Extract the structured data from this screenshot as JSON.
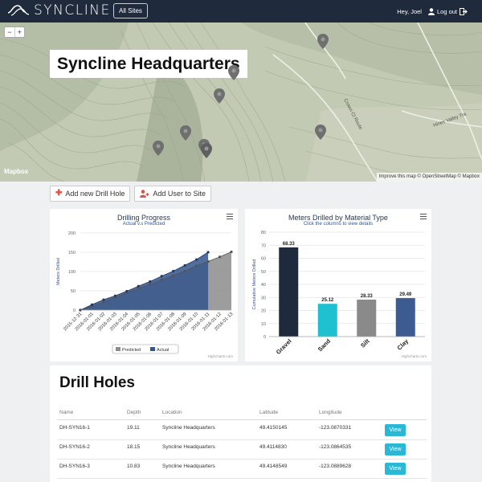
{
  "navbar": {
    "brand": "SYNCLINE",
    "all_sites_label": "All Sites",
    "greeting": "Hey, Joel",
    "logout_label": "Log out"
  },
  "map": {
    "title": "Syncline Headquarters",
    "zoom_in": "+",
    "zoom_out": "−",
    "logo": "Mapbox",
    "attribution": "Improve this map © OpenStreetMap © Mapbox",
    "road_labels": [
      "Crown Ct Route",
      "Hines Valley Tra"
    ]
  },
  "actions": {
    "add_drill_hole": "Add new Drill Hole",
    "add_user": "Add User to Site"
  },
  "chart_drilling": {
    "title": "Drilling Progress",
    "subtitle": "Actual v.s Predicted",
    "credits": "Highcharts.com"
  },
  "chart_material": {
    "title": "Meters Drilled by Material Type",
    "subtitle": "Click the columns to view details",
    "credits": "Highcharts.com"
  },
  "chart_data": [
    {
      "type": "area",
      "title": "Drilling Progress",
      "subtitle": "Actual v.s Predicted",
      "ylabel": "Meters Drilled",
      "ylim": [
        0,
        200
      ],
      "yticks": [
        0,
        50,
        100,
        150,
        200
      ],
      "categories": [
        "2015-12-31",
        "2016-01-01",
        "2016-01-02",
        "2016-01-03",
        "2016-01-04",
        "2016-01-05",
        "2016-01-06",
        "2016-01-07",
        "2016-01-08",
        "2016-01-09",
        "2016-01-10",
        "2016-01-11",
        "2016-01-12",
        "2016-01-13"
      ],
      "series": [
        {
          "name": "Predicted",
          "color": "#8c8c8c",
          "values": [
            0,
            10,
            21,
            33,
            45,
            56,
            67,
            79,
            90,
            101,
            115,
            126,
            138,
            151
          ]
        },
        {
          "name": "Actual",
          "color": "#34558b",
          "values": [
            0,
            14,
            27,
            37,
            49,
            62,
            74,
            88,
            101,
            116,
            131,
            150,
            null,
            null
          ]
        }
      ],
      "legend": "bottom"
    },
    {
      "type": "bar",
      "title": "Meters Drilled by Material Type",
      "subtitle": "Click the columns to view details",
      "ylabel": "Cumulative Meters Drilled",
      "ylim": [
        0,
        80
      ],
      "yticks": [
        0,
        10,
        20,
        30,
        40,
        50,
        60,
        70,
        80
      ],
      "categories": [
        "Gravel",
        "Sand",
        "Silt",
        "Clay"
      ],
      "values": [
        68.33,
        25.12,
        28.33,
        29.49
      ],
      "data_labels": [
        "68.33",
        "25.12",
        "28.33",
        "29.49"
      ],
      "colors": [
        "#1f2a3c",
        "#1fc0d0",
        "#8a8a8a",
        "#3c5b91"
      ]
    }
  ],
  "drill_holes": {
    "title": "Drill Holes",
    "columns": [
      "Name",
      "Depth",
      "Location",
      "Latitude",
      "Longitude"
    ],
    "view_label": "View",
    "rows": [
      {
        "name": "DH-SYN16-1",
        "depth": "19.11",
        "location": "Syncline Headquarters",
        "lat": "49.4150145",
        "lon": "-123.0870331"
      },
      {
        "name": "DH-SYN16-2",
        "depth": "18.15",
        "location": "Syncline Headquarters",
        "lat": "49.4114830",
        "lon": "-123.0864535"
      },
      {
        "name": "DH-SYN16-3",
        "depth": "10.83",
        "location": "Syncline Headquarters",
        "lat": "49.4148549",
        "lon": "-123.0889628"
      }
    ]
  },
  "colors": {
    "navbar": "#1f2a3c",
    "view_button": "#2bb7d6",
    "add_icon": "#d9534f"
  }
}
